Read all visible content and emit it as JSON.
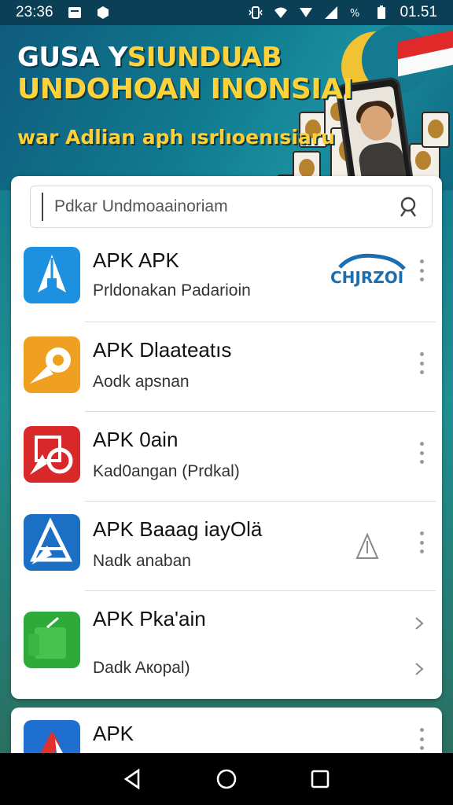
{
  "status_bar": {
    "time": "23:36",
    "clock_right": "01.51",
    "icons": [
      "notification-box-icon",
      "hexagon-icon",
      "vibrate-icon",
      "wifi-icon",
      "signal-icon",
      "percent-icon",
      "battery-icon"
    ]
  },
  "banner": {
    "title_line1_a": "GUSA Y",
    "title_line1_b": "SIUNDUAB",
    "title_line2": "UNDOHOAN INONSIAI",
    "subtitle": "war Adlian aph ısrlıoenısiaru"
  },
  "search": {
    "placeholder": "Pdkar Undmoaainoriam"
  },
  "apps": [
    {
      "title": "APK APK",
      "subtitle": "Prldonakan Padarioin",
      "icon_color": "#1e90e0",
      "icon": "rocket-a-icon",
      "brand": "CHJRZOI"
    },
    {
      "title": "APK Dlaateatıs",
      "subtitle": "Aodk apsnan",
      "icon_color": "#f0a020",
      "icon": "megaphone-icon"
    },
    {
      "title": "APK 0ain",
      "subtitle": "Kad0angan (Prdkal)",
      "icon_color": "#d8282a",
      "icon": "photo-wheel-icon"
    },
    {
      "title": "APK Baaag iayOlä",
      "subtitle": "Nadk anaban",
      "icon_color": "#1b6fc4",
      "icon": "delta-a-icon"
    },
    {
      "title": "APK Pka'ain",
      "subtitle": "Dadk Aкopal)",
      "icon_color": "#2eaa3a",
      "icon": "green-box-icon"
    }
  ],
  "partial_app": {
    "title": "APK",
    "icon_color": "#1e6fd0"
  },
  "colors": {
    "status_bar": "#0b3f55",
    "banner_yellow": "#ffd23a",
    "nav_bar": "#000000"
  }
}
